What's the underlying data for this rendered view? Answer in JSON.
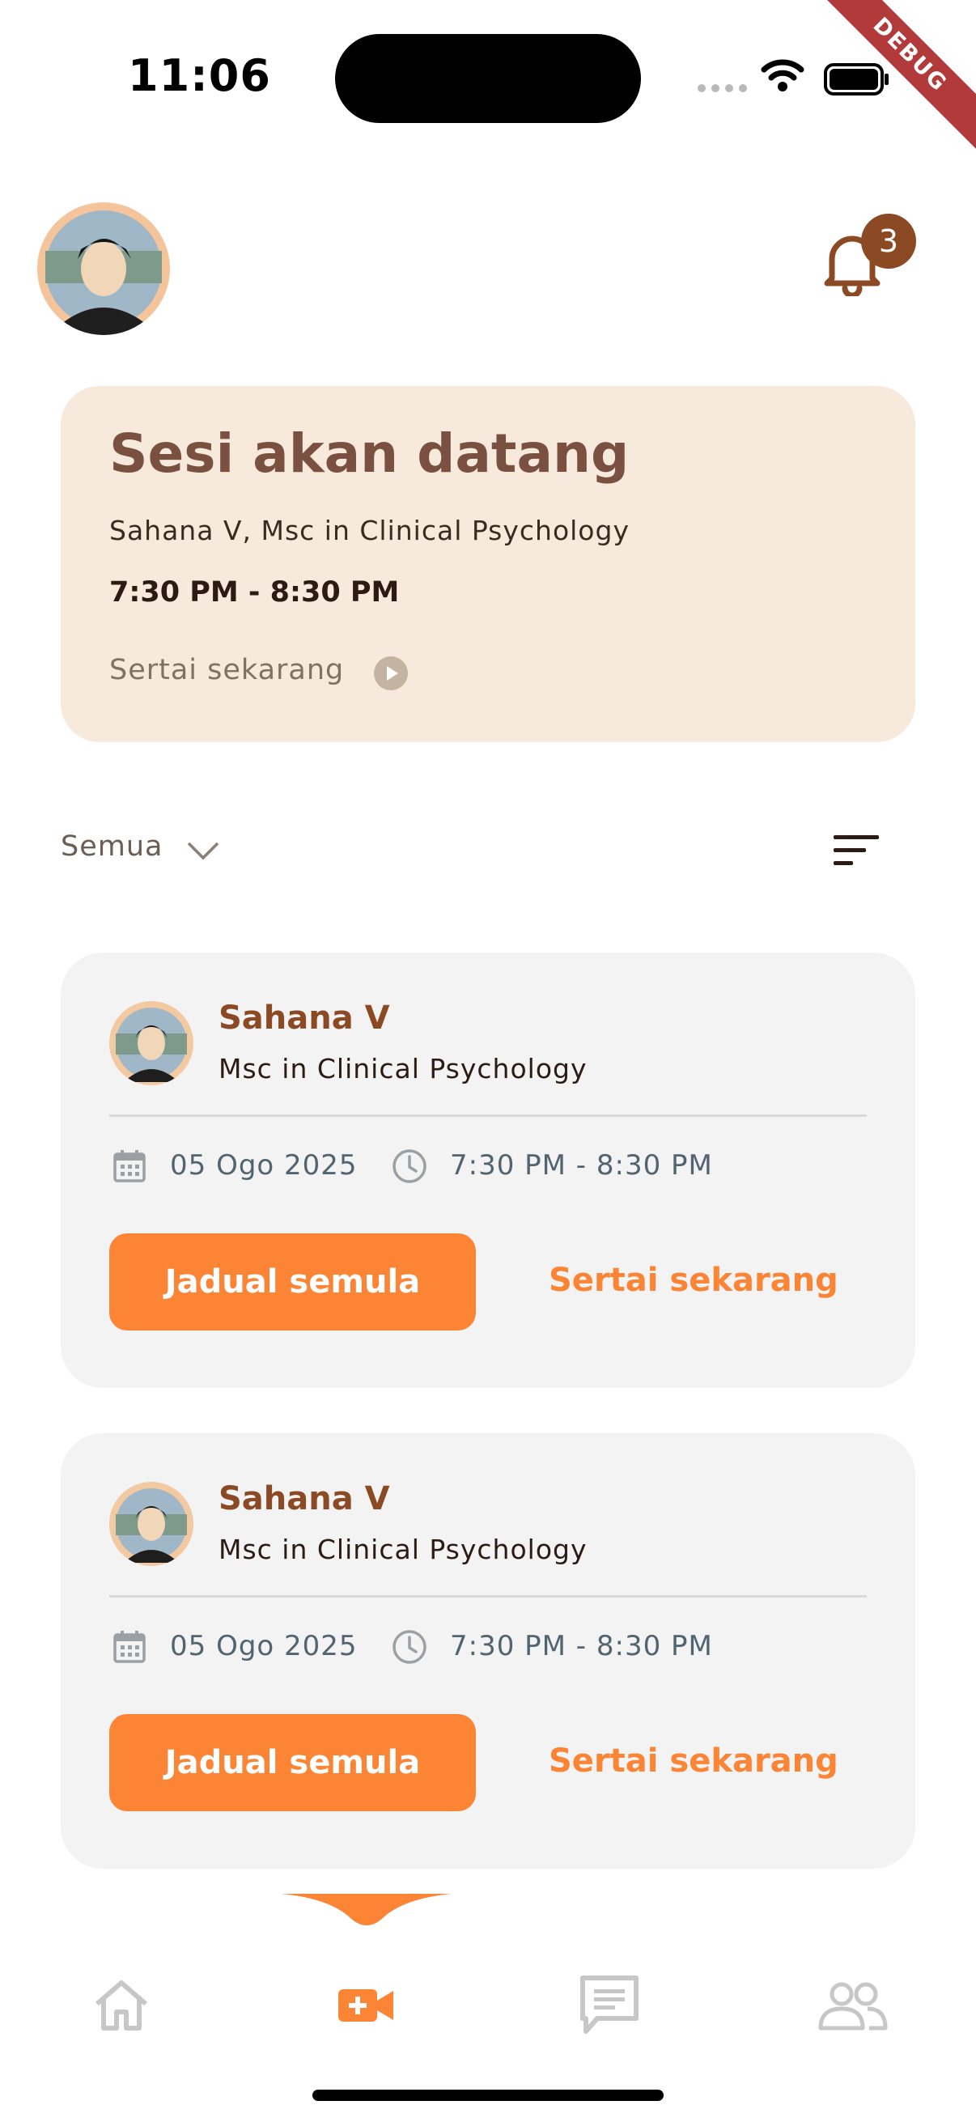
{
  "status_bar": {
    "time": "11:06",
    "debug_banner": "DEBUG"
  },
  "header": {
    "notification_count": "3"
  },
  "upcoming": {
    "title": "Sesi akan datang",
    "doctor": "Sahana V, Msc in Clinical Psychology",
    "time": "7:30 PM - 8:30 PM",
    "join_label": "Sertai sekarang"
  },
  "filter": {
    "selected": "Semua"
  },
  "sessions": [
    {
      "name": "Sahana V",
      "qualification": "Msc in Clinical Psychology",
      "date": "05 Ogo 2025",
      "time": "7:30 PM - 8:30 PM",
      "reschedule_label": "Jadual semula",
      "join_label": "Sertai sekarang"
    },
    {
      "name": "Sahana V",
      "qualification": "Msc in Clinical Psychology",
      "date": "05 Ogo 2025",
      "time": "7:30 PM - 8:30 PM",
      "reschedule_label": "Jadual semula",
      "join_label": "Sertai sekarang"
    }
  ],
  "bottom_nav": {
    "items": [
      {
        "icon": "home-icon",
        "active": false
      },
      {
        "icon": "video-plus-icon",
        "active": true
      },
      {
        "icon": "message-icon",
        "active": false
      },
      {
        "icon": "users-icon",
        "active": false
      }
    ]
  },
  "colors": {
    "accent": "#fb8435",
    "brown": "#8b4a24",
    "card_bg": "#f3f3f3",
    "upcoming_bg": "#f7eadd"
  }
}
